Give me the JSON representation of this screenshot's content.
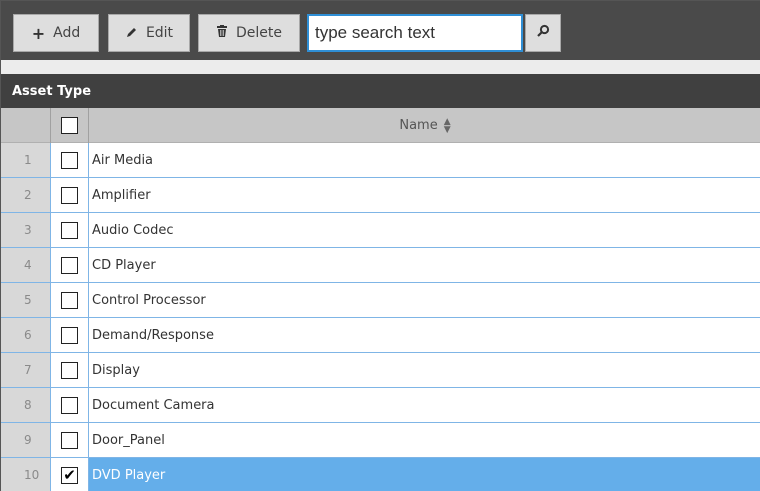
{
  "toolbar": {
    "add_label": "Add",
    "edit_label": "Edit",
    "delete_label": "Delete",
    "search_placeholder": "type search text"
  },
  "grid": {
    "caption": "Asset Type",
    "column_name": "Name",
    "rows": [
      {
        "num": "1",
        "name": "Air Media",
        "checked": false
      },
      {
        "num": "2",
        "name": "Amplifier",
        "checked": false
      },
      {
        "num": "3",
        "name": "Audio Codec",
        "checked": false
      },
      {
        "num": "4",
        "name": "CD Player",
        "checked": false
      },
      {
        "num": "5",
        "name": "Control Processor",
        "checked": false
      },
      {
        "num": "6",
        "name": "Demand/Response",
        "checked": false
      },
      {
        "num": "7",
        "name": "Display",
        "checked": false
      },
      {
        "num": "8",
        "name": "Document Camera",
        "checked": false
      },
      {
        "num": "9",
        "name": "Door_Panel",
        "checked": false
      },
      {
        "num": "10",
        "name": "DVD Player",
        "checked": true
      }
    ]
  },
  "colors": {
    "toolbar_bg": "#4a4a4a",
    "caption_bg": "#404040",
    "selected_row": "#64aeea",
    "grid_line": "#7fb5e6",
    "search_border": "#2f8fd6"
  }
}
